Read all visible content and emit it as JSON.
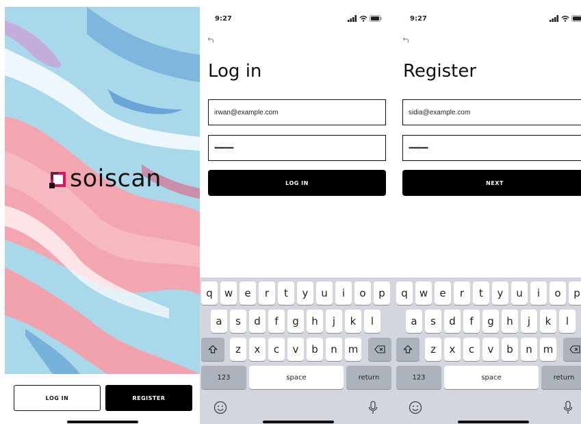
{
  "splash": {
    "brand": "soiscan",
    "login_label": "LOG IN",
    "register_label": "REGISTER",
    "colors": {
      "pink": "#f2a3ad",
      "blue": "#a7d7ea",
      "accent": "#e0115f"
    }
  },
  "login": {
    "time": "9:27",
    "back_icon": "undo-icon",
    "title": "Log in",
    "email_value": "irwan@example.com",
    "password_value": "•••••••••••••",
    "button_label": "LOG IN"
  },
  "register": {
    "time": "9:27",
    "back_icon": "undo-icon",
    "title": "Register",
    "email_value": "sidia@example.com",
    "password_value": "•••••••••••••",
    "button_label": "NEXT"
  },
  "keyboard": {
    "row1": [
      "q",
      "w",
      "e",
      "r",
      "t",
      "y",
      "u",
      "i",
      "o",
      "p"
    ],
    "row2": [
      "a",
      "s",
      "d",
      "f",
      "g",
      "h",
      "j",
      "k",
      "l"
    ],
    "row3": [
      "z",
      "x",
      "c",
      "v",
      "b",
      "n",
      "m"
    ],
    "numbers_label": "123",
    "space_label": "space",
    "return_label": "return",
    "icons": [
      "shift-icon",
      "backspace-icon",
      "emoji-icon",
      "microphone-icon"
    ]
  }
}
